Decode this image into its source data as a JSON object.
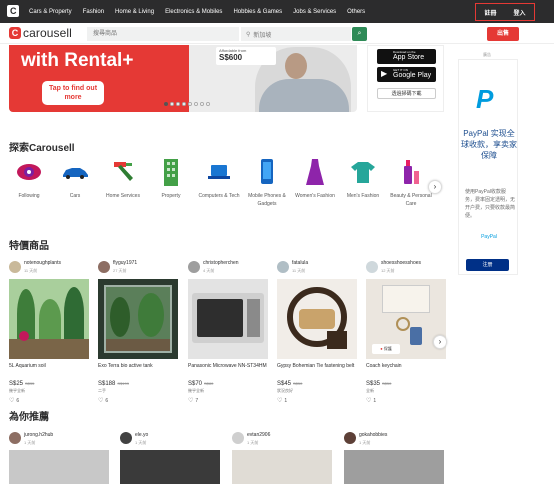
{
  "topnav": {
    "categories": [
      "Cars & Property",
      "Fashion",
      "Home & Living",
      "Electronics & Mobiles",
      "Hobbies & Games",
      "Jobs & Services",
      "Others"
    ],
    "register": "註冊",
    "login": "登入"
  },
  "search": {
    "brand": "carousell",
    "placeholder": "搜尋商品",
    "location": "新加坡",
    "sell": "出售"
  },
  "hero": {
    "headline": "with Rental+",
    "cta": "Tap to find out more",
    "card_label": "Affordable from",
    "card_price": "S$600",
    "slide_count": 8,
    "active_slide": 1
  },
  "apps": {
    "appstore_small": "Download on the",
    "appstore_big": "App Store",
    "googleplay_small": "GET IT ON",
    "googleplay_big": "Google Play",
    "download": "透過掃碼下載"
  },
  "ad": {
    "label": "廣告",
    "headline": "PayPal 实现全球收款，享卖家保障",
    "body": "使用PayPal收款服务，费率固定透明，无开户费，只要收款最简便。",
    "brand": "PayPal",
    "register": "注册"
  },
  "explore": {
    "title": "探索Carousell",
    "categories": [
      {
        "label": "Following",
        "icon": "eye-icon"
      },
      {
        "label": "Cars",
        "icon": "car-icon"
      },
      {
        "label": "Home Services",
        "icon": "spray-bottle-icon"
      },
      {
        "label": "Property",
        "icon": "building-icon"
      },
      {
        "label": "Computers & Tech",
        "icon": "laptop-icon"
      },
      {
        "label": "Mobile Phones & Gadgets",
        "icon": "phone-icon"
      },
      {
        "label": "Women's Fashion",
        "icon": "dress-icon"
      },
      {
        "label": "Men's Fashion",
        "icon": "tshirt-icon"
      },
      {
        "label": "Beauty & Personal Care",
        "icon": "cosmetics-icon"
      }
    ]
  },
  "deals": {
    "title": "特價商品",
    "protected_label": "保護",
    "items": [
      {
        "user": "notenoughplants",
        "time": "11 天前",
        "title": "5L Aquarium soil",
        "price": "S$25",
        "old_price": "S$35",
        "condition": "幾乎全新",
        "likes": "6"
      },
      {
        "user": "flyguy1971",
        "time": "27 天前",
        "title": "Exo Terra bio active tank",
        "price": "S$188",
        "old_price": "S$199",
        "condition": "二手",
        "likes": "6"
      },
      {
        "user": "christopherchen",
        "time": "4 天前",
        "title": "Panasonic Microwave NN-ST34HM",
        "price": "S$70",
        "old_price": "S$80",
        "condition": "幾乎全新",
        "likes": "7"
      },
      {
        "user": "fatalula",
        "time": "11 天前",
        "title": "Gypsy Bohemian Tie fastening belt",
        "price": "S$45",
        "old_price": "S$50",
        "condition": "狀況良好",
        "likes": "1"
      },
      {
        "user": "shoesshoesshoes",
        "time": "12 天前",
        "title": "Coach keychain",
        "price": "S$35",
        "old_price": "S$50",
        "condition": "全新",
        "likes": "1"
      }
    ]
  },
  "recs": {
    "title": "為你推薦",
    "items": [
      {
        "user": "jurong.h2hub",
        "time": "1 天前"
      },
      {
        "user": "ele.yo",
        "time": "1 天前"
      },
      {
        "user": "evtan2906",
        "time": "1 天前"
      },
      {
        "user": "gokahobbies",
        "time": "1 天前"
      }
    ]
  }
}
